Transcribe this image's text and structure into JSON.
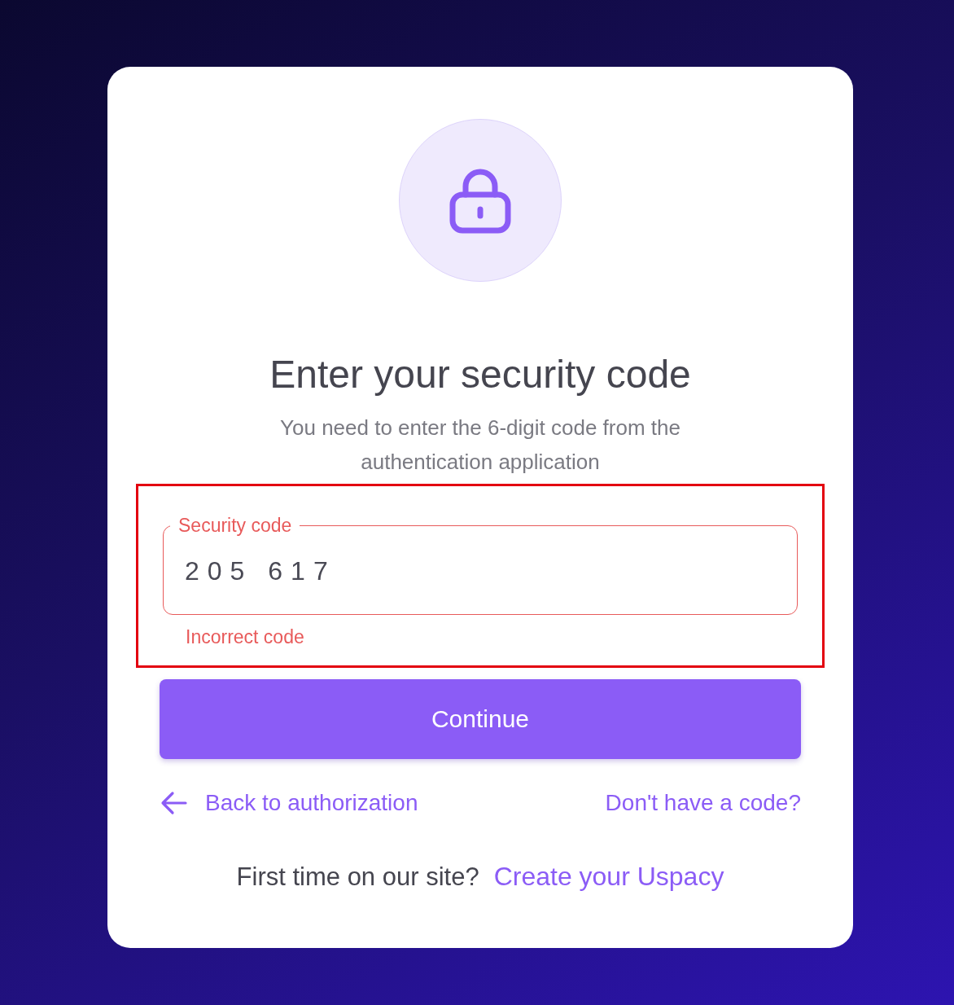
{
  "title": "Enter your security code",
  "subtitle": "You need to enter the 6-digit code from the authentication application",
  "code_field": {
    "label": "Security code",
    "value": "205 617",
    "error": "Incorrect code",
    "invalid": true,
    "highlighted": true
  },
  "continue_button": "Continue",
  "back_link": "Back to authorization",
  "no_code_link": "Don't have a code?",
  "footer": {
    "text": "First time on our site?",
    "link": "Create your Uspacy"
  }
}
